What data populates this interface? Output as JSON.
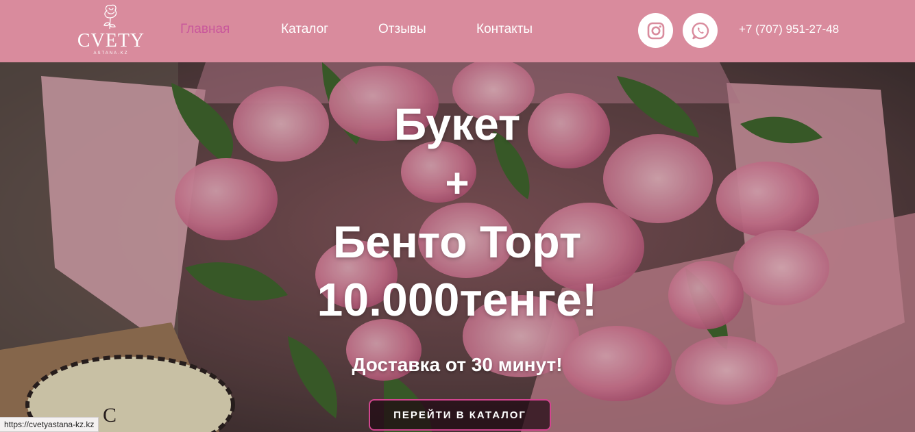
{
  "brand": {
    "logo_word": "CVETY",
    "logo_sub": "ASTANA.KZ"
  },
  "nav": {
    "home": "Главная",
    "catalog": "Каталог",
    "reviews": "Отзывы",
    "contacts": "Контакты"
  },
  "social": {
    "instagram_icon": "instagram-icon",
    "whatsapp_icon": "whatsapp-icon"
  },
  "phone": "+7 (707) 951-27-48",
  "hero": {
    "line1": "Букет",
    "line2": "+",
    "line3": "Бенто Торт",
    "line4": "10.000тенге!",
    "subtitle": "Доставка от 30 минут!",
    "cta": "ПЕРЕЙТИ В КАТАЛОГ"
  },
  "status_bar": {
    "url": "https://cvetyastana-kz.kz"
  },
  "colors": {
    "header_bg": "#d98b9d",
    "nav_active": "#c9579b",
    "cta_border": "#d2458f"
  }
}
